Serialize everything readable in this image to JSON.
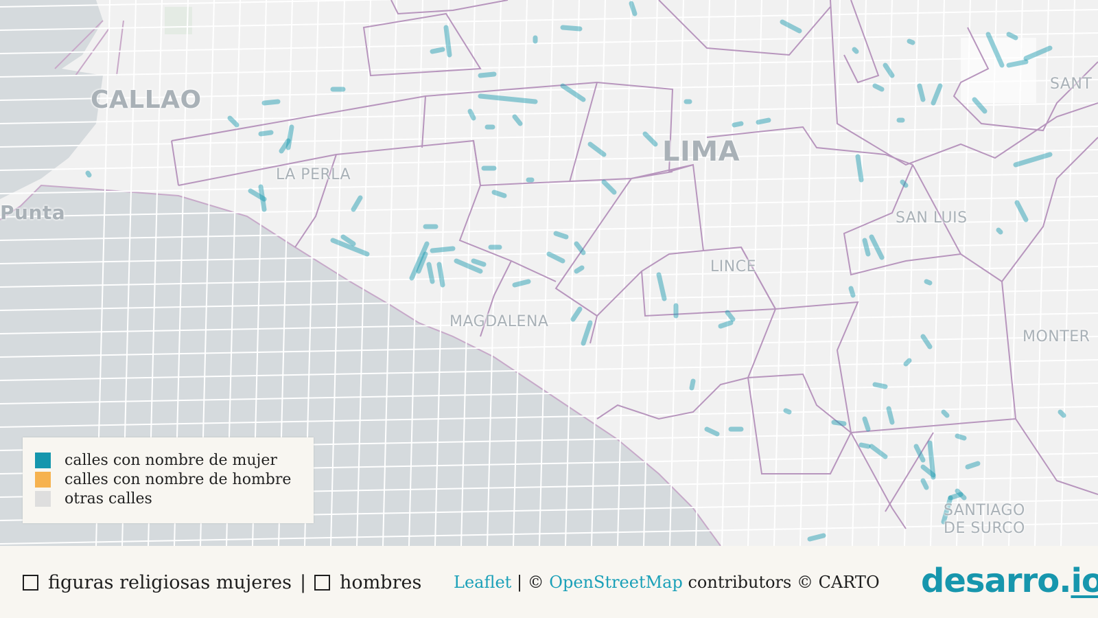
{
  "map": {
    "places": [
      {
        "label": "CALLAO"
      },
      {
        "label": "LIMA"
      },
      {
        "label": "LA PERLA"
      },
      {
        "label": "Punta"
      },
      {
        "label": "SAN LUIS"
      },
      {
        "label": "LINCE"
      },
      {
        "label": "MAGDALENA"
      },
      {
        "label": "SANT"
      },
      {
        "label": "MONTER"
      },
      {
        "label": "SANTIAGO"
      },
      {
        "label": "DE SURCO"
      }
    ],
    "colors": {
      "sea": "#d5dadd",
      "land": "#f1f1f1",
      "district_border": "#b795bd",
      "women_street": "#1596ad"
    }
  },
  "legend": {
    "items": [
      {
        "label": "calles con nombre de mujer",
        "color": "#1596ad"
      },
      {
        "label": "calles con nombre de hombre",
        "color": "#f6b24f"
      },
      {
        "label": "otras calles",
        "color": "#dedede"
      }
    ]
  },
  "footer": {
    "filter_women_label": "figuras religiosas mujeres",
    "separator": "|",
    "filter_men_label": "hombres",
    "attribution": {
      "leaflet": "Leaflet",
      "sep1": " | © ",
      "osm": "OpenStreetMap",
      "rest": " contributors © CARTO"
    },
    "brand_main": "desarro.",
    "brand_tail": "io"
  }
}
